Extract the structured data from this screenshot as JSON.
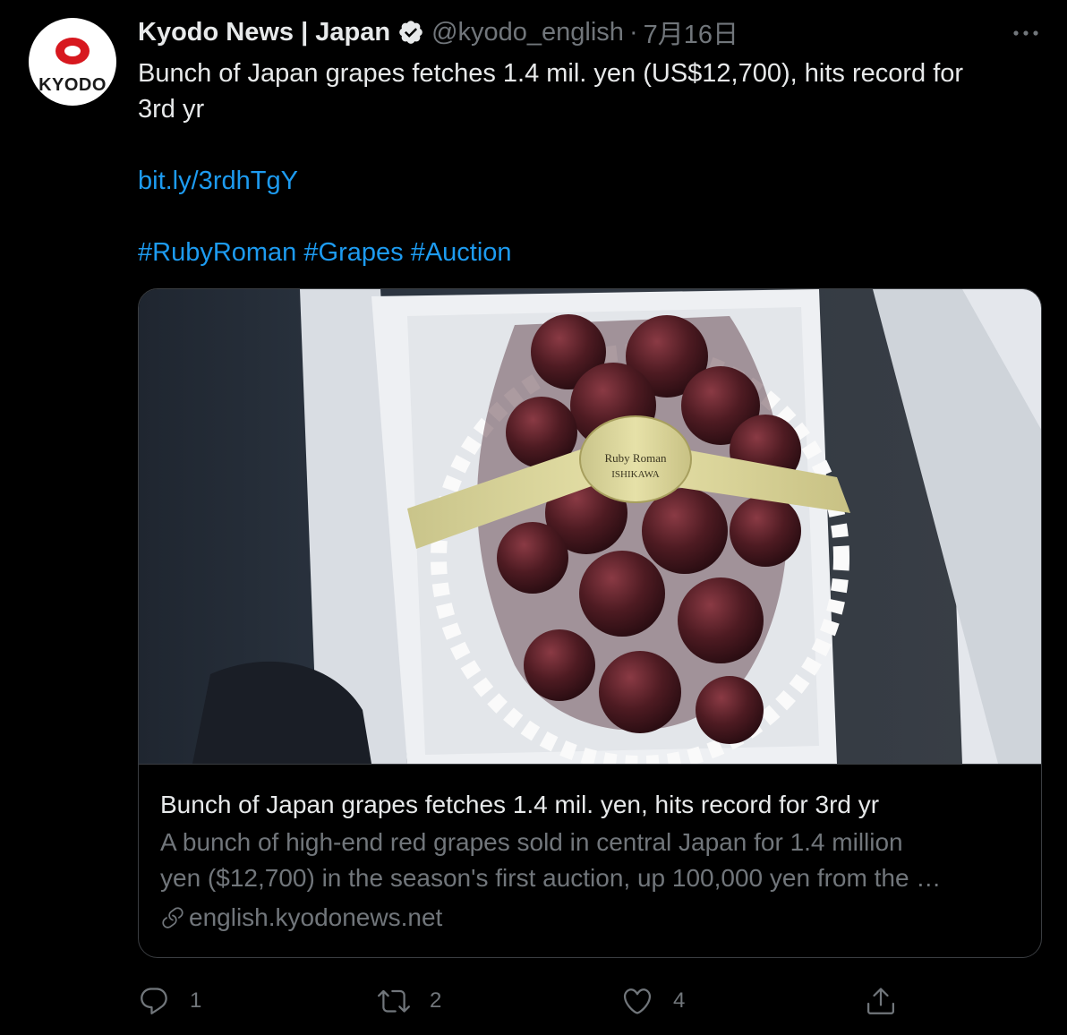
{
  "author": {
    "display_name": "Kyodo News | Japan",
    "handle": "@kyodo_english",
    "separator": "·",
    "date": "7月16日",
    "avatar_text": "KYODO",
    "verified": true
  },
  "tweet": {
    "text_line1": "Bunch of Japan grapes fetches 1.4 mil. yen (US$12,700), hits record for",
    "text_line2": "3rd yr",
    "short_link": "bit.ly/3rdhTgY",
    "hashtags": [
      "#RubyRoman",
      "#Grapes",
      "#Auction"
    ]
  },
  "card": {
    "image_subject": "Ruby Roman grapes in a white gift box",
    "image_label_line1": "Ruby Roman",
    "image_label_line2": "ISHIKAWA",
    "title": "Bunch of Japan grapes fetches 1.4 mil. yen, hits record for 3rd yr",
    "description_line1": "A bunch of high-end red grapes sold in central Japan for 1.4 million",
    "description_line2": "yen ($12,700) in the season's first auction, up 100,000 yen from the …",
    "domain": "english.kyodonews.net"
  },
  "actions": {
    "reply_count": "1",
    "retweet_count": "2",
    "like_count": "4"
  },
  "icons": {
    "more": "more-dots-icon",
    "verified": "verified-badge-icon",
    "reply": "reply-icon",
    "retweet": "retweet-icon",
    "like": "heart-icon",
    "share": "share-icon",
    "link": "link-icon"
  },
  "colors": {
    "background": "#000000",
    "text": "#e7e9ea",
    "secondary": "#71767b",
    "link": "#1d9bf0",
    "brand_red": "#d7181f"
  }
}
